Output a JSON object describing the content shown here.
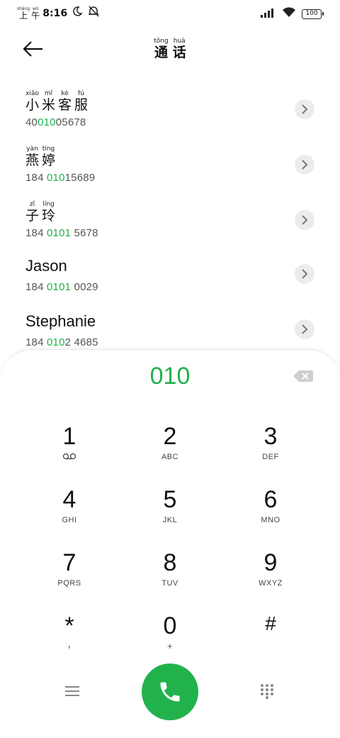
{
  "status_bar": {
    "period_pinyin": [
      "shàng",
      "wǔ"
    ],
    "period_chars": [
      "上",
      "午"
    ],
    "time": "8:16",
    "battery": "100"
  },
  "header": {
    "title_pinyin": [
      "tōng",
      "huà"
    ],
    "title_chars": [
      "通",
      "话"
    ]
  },
  "contacts": [
    {
      "pinyin": [
        "xiǎo",
        "mǐ",
        "kè",
        "fú"
      ],
      "chars": [
        "小",
        "米",
        "客",
        "服"
      ],
      "number_pre": "40",
      "number_hl": "010",
      "number_post": "05678"
    },
    {
      "pinyin": [
        "yàn",
        "tíng"
      ],
      "chars": [
        "燕",
        "婷"
      ],
      "number_pre": "184 ",
      "number_hl": "010",
      "number_post": "15689"
    },
    {
      "pinyin": [
        "zǐ",
        "líng"
      ],
      "chars": [
        "子",
        "玲"
      ],
      "number_pre": "184 ",
      "number_hl": "0101",
      "number_post": " 5678"
    },
    {
      "name": "Jason",
      "number_pre": "184 ",
      "number_hl": "0101",
      "number_post": " 0029"
    },
    {
      "name": "Stephanie",
      "number_pre": "184 ",
      "number_hl": "010",
      "number_post": "2 4685"
    }
  ],
  "dialer": {
    "input": "010",
    "keys": [
      {
        "digit": "1",
        "sub": ""
      },
      {
        "digit": "2",
        "sub": "ABC"
      },
      {
        "digit": "3",
        "sub": "DEF"
      },
      {
        "digit": "4",
        "sub": "GHI"
      },
      {
        "digit": "5",
        "sub": "JKL"
      },
      {
        "digit": "6",
        "sub": "MNO"
      },
      {
        "digit": "7",
        "sub": "PQRS"
      },
      {
        "digit": "8",
        "sub": "TUV"
      },
      {
        "digit": "9",
        "sub": "WXYZ"
      },
      {
        "digit": "*",
        "sub": ","
      },
      {
        "digit": "0",
        "sub": "+"
      },
      {
        "digit": "#",
        "sub": ""
      }
    ]
  },
  "colors": {
    "accent": "#21b14b",
    "call_button": "#22b24c"
  },
  "icons": [
    "moon-icon",
    "muted-bell-icon",
    "signal-icon",
    "wifi-icon",
    "battery-icon",
    "back-arrow-icon",
    "chevron-right-icon",
    "backspace-icon",
    "voicemail-icon",
    "menu-icon",
    "phone-icon",
    "keypad-icon"
  ]
}
